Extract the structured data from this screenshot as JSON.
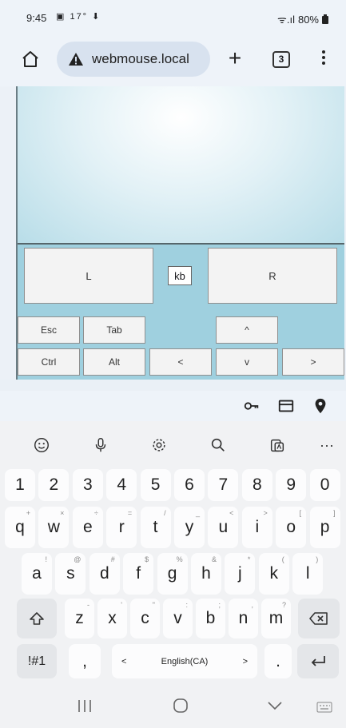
{
  "status_bar": {
    "time": "9:45",
    "notif_icons": "▣ 17° ⬇",
    "signal_text": "ᯤ.ıl",
    "battery": "80%"
  },
  "browser": {
    "url": "webmouse.local",
    "tab_count": "3",
    "plus_label": "+"
  },
  "webpage": {
    "left_button": "L",
    "right_button": "R",
    "kb_button": "kb",
    "keys": {
      "esc": "Esc",
      "tab": "Tab",
      "up": "^",
      "ctrl": "Ctrl",
      "alt": "Alt",
      "left": "<",
      "down": "v",
      "right": ">"
    }
  },
  "keyboard": {
    "toolbar_more": "···",
    "number_row": [
      "1",
      "2",
      "3",
      "4",
      "5",
      "6",
      "7",
      "8",
      "9",
      "0"
    ],
    "row1": [
      "q",
      "w",
      "e",
      "r",
      "t",
      "y",
      "u",
      "i",
      "o",
      "p"
    ],
    "row1_hints": [
      "+",
      "×",
      "÷",
      "=",
      "/",
      "_",
      "<",
      ">",
      "[",
      "]"
    ],
    "row2": [
      "a",
      "s",
      "d",
      "f",
      "g",
      "h",
      "j",
      "k",
      "l"
    ],
    "row2_hints": [
      "!",
      "@",
      "#",
      "$",
      "%",
      "&",
      "*",
      "(",
      ")"
    ],
    "row3": [
      "z",
      "x",
      "c",
      "v",
      "b",
      "n",
      "m"
    ],
    "row3_hints": [
      "-",
      "'",
      "\"",
      ":",
      ";",
      ",",
      "?"
    ],
    "symbols_key": "!#1",
    "comma_key": ",",
    "space_label": "English(CA)",
    "space_left": "<",
    "space_right": ">",
    "period_key": "."
  },
  "colors": {
    "page_bg": "#9fd0df",
    "keyboard_bg": "#f1f2f4",
    "url_pill": "#d8e2ef"
  }
}
